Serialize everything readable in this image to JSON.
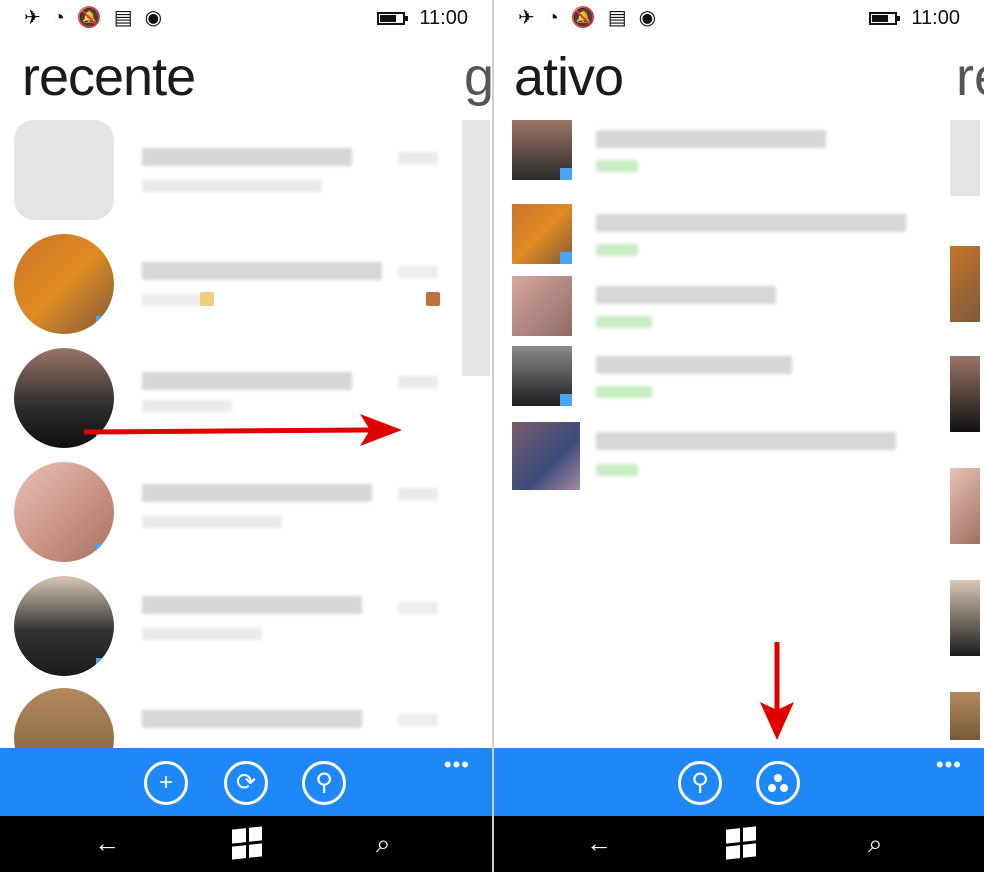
{
  "left_screen": {
    "status": {
      "time": "11:00"
    },
    "pivot_title": "recente",
    "pivot_next": "g",
    "appbar": {
      "buttons": [
        "plus-circle-icon",
        "sync-icon",
        "search-icon"
      ],
      "more": "•••"
    }
  },
  "right_screen": {
    "status": {
      "time": "11:00"
    },
    "pivot_title": "ativo",
    "pivot_next": "re",
    "appbar": {
      "buttons": [
        "search-icon",
        "group-icon"
      ],
      "more": "•••"
    }
  },
  "nav": {
    "back": "←",
    "search": "⌕"
  },
  "colors": {
    "appbar": "#1e88f7",
    "annotation_arrow": "#e10000",
    "status_green": "#7ad36b"
  }
}
